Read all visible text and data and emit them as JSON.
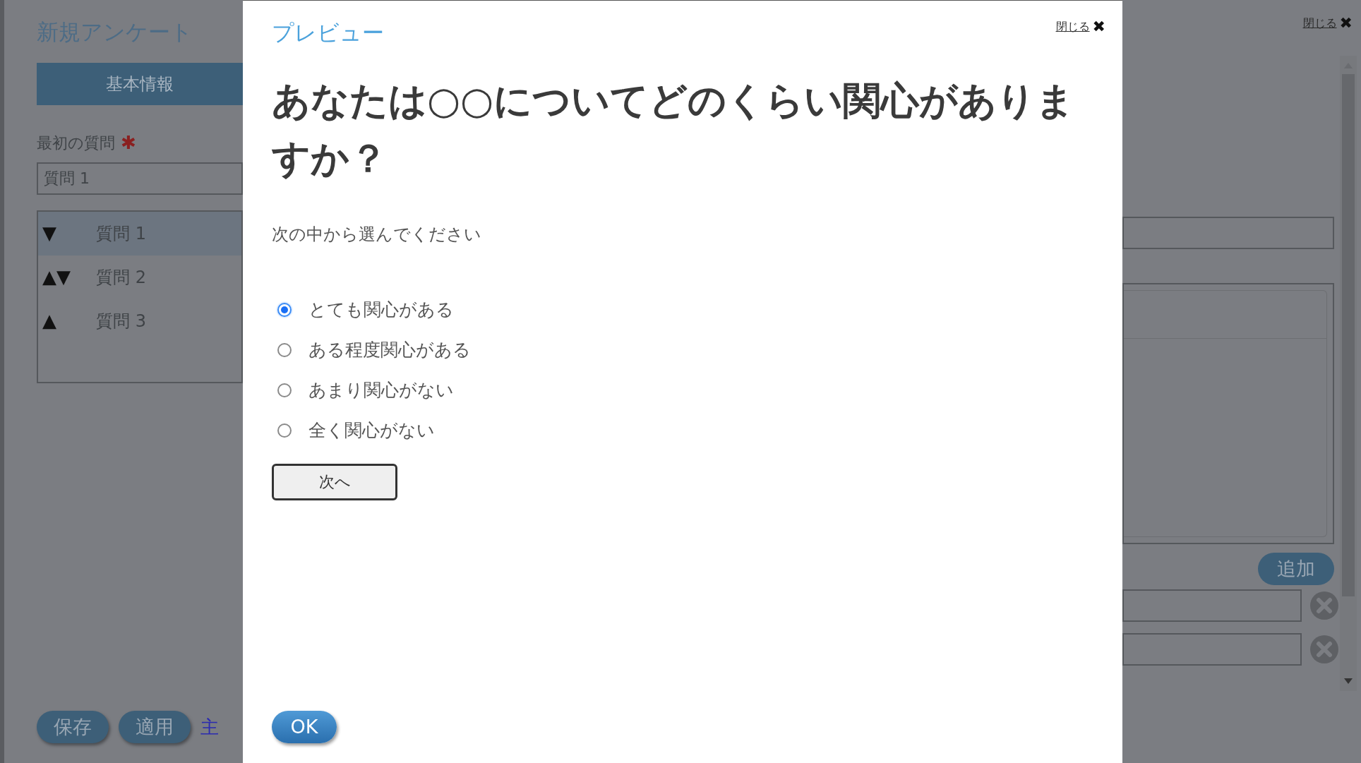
{
  "background": {
    "title": "新規アンケート",
    "tabs": [
      {
        "label": "基本情報",
        "selected": true
      }
    ],
    "first_question": {
      "label": "最初の質問",
      "required_mark": "✱",
      "value": "質問 1"
    },
    "question_list": [
      {
        "arrows": "▼",
        "label": "質問 1",
        "selected": true
      },
      {
        "arrows": "▲▼",
        "label": "質問 2",
        "selected": false
      },
      {
        "arrows": "▲",
        "label": "質問 3",
        "selected": false
      }
    ],
    "footer_buttons": [
      "保存",
      "適用"
    ],
    "footer_link": "主",
    "close_label": "閉じる",
    "close_icon": "✖",
    "add_button": "追加"
  },
  "modal": {
    "title": "プレビュー",
    "close_label": "閉じる",
    "close_icon": "✖",
    "question": "あなたは○○についてどのくらい関心がありますか？",
    "instruction": "次の中から選んでください",
    "options": [
      {
        "label": "とても関心がある",
        "selected": true
      },
      {
        "label": "ある程度関心がある",
        "selected": false
      },
      {
        "label": "あまり関心がない",
        "selected": false
      },
      {
        "label": "全く関心がない",
        "selected": false
      }
    ],
    "next_button": "次へ",
    "ok_button": "OK"
  }
}
